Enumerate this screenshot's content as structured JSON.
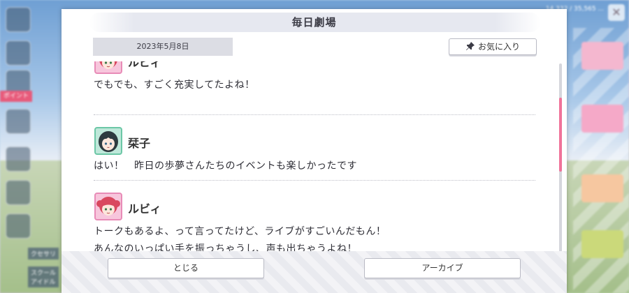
{
  "dialog": {
    "title": "毎日劇場",
    "date": "2023年5月8日",
    "favorite_label": "お気に入り",
    "close_label": "とじる",
    "archive_label": "アーカイブ"
  },
  "messages": [
    {
      "speaker": "ルビィ",
      "avatar": "ruby-portrait",
      "lines": [
        "でもでも、すごく充実してたよね！"
      ]
    },
    {
      "speaker": "栞子",
      "avatar": "shioriko-portrait",
      "lines": [
        "はい！　昨日の歩夢さんたちのイベントも楽しかったです"
      ]
    },
    {
      "speaker": "ルビィ",
      "avatar": "ruby-portrait",
      "lines": [
        "トークもあるよ、って言ってたけど、ライブがすごいんだもん！",
        "あんなのいっぱい手を振っちゃうし、声も出ちゃうよね！"
      ]
    }
  ],
  "background": {
    "side_tag": "ポイント",
    "label_1": "クセサリ",
    "label_2": "スクール\nアイドル",
    "hud_text": "14,332 / 35,565 ...",
    "close_glyph": "✕"
  },
  "colors": {
    "accent_pink": "#f0739a",
    "ruby_frame": "#e88bb7",
    "shioriko_frame": "#6cc7a6"
  }
}
